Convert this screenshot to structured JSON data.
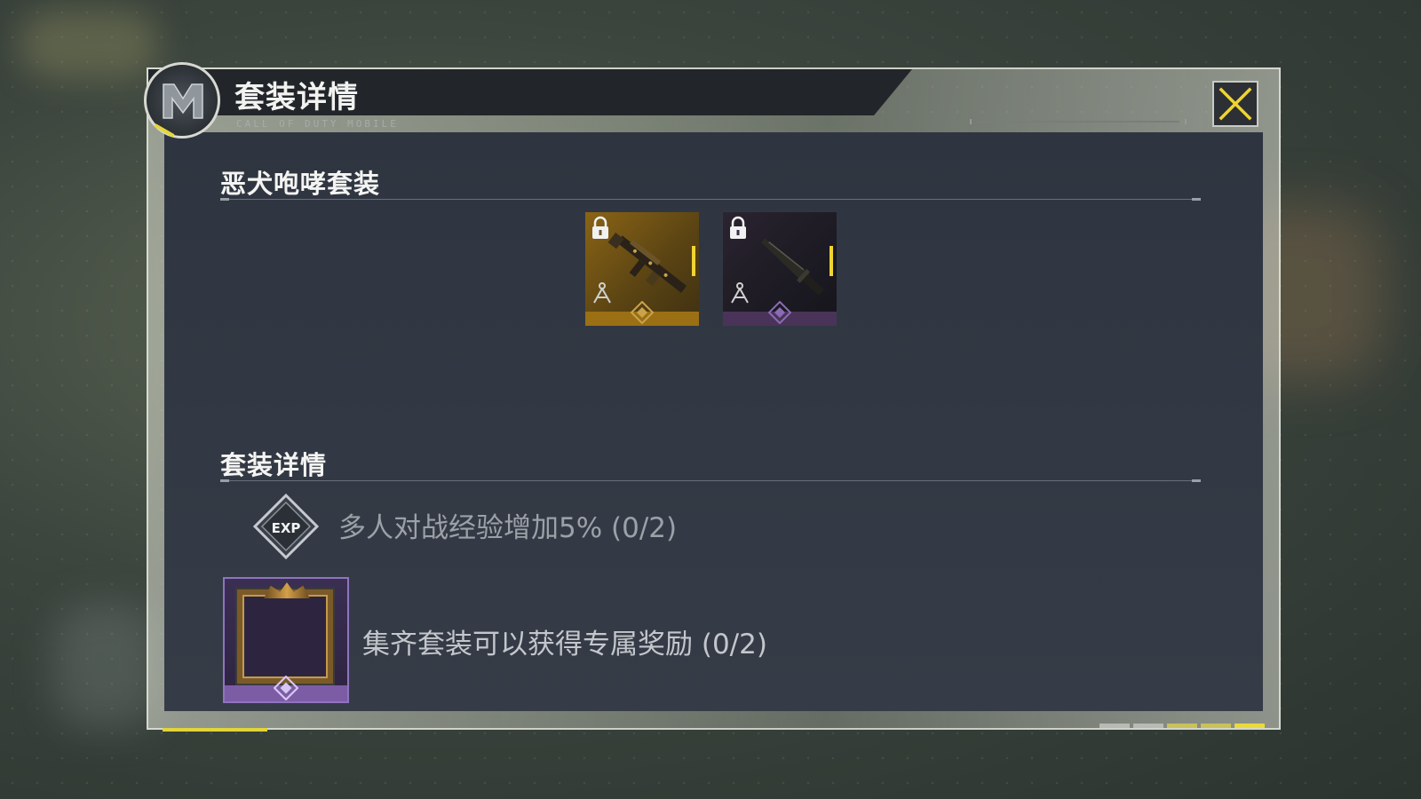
{
  "header": {
    "title": "套装详情",
    "subtitle": "CALL OF DUTY MOBILE"
  },
  "set": {
    "section_title": "恶犬咆哮套装",
    "items": [
      {
        "rarity": "legendary",
        "color": "#9b6f14",
        "icon": "assault-rifle-icon",
        "locked": true
      },
      {
        "rarity": "epic",
        "color": "#4a3358",
        "icon": "knife-icon",
        "locked": true
      }
    ]
  },
  "details": {
    "section_title": "套装详情",
    "bonus": {
      "icon": "exp-boost-icon",
      "icon_text": "EXP",
      "text": "多人对战经验增加5% (0/2)"
    },
    "reward": {
      "icon": "avatar-frame-icon",
      "text": "集齐套装可以获得专属奖励 (0/2)"
    }
  },
  "pager": {
    "pages": 5,
    "colors": [
      "#b8bab5",
      "#b8bab5",
      "#c9c25a",
      "#c9c25a",
      "#ebd93b"
    ]
  },
  "colors": {
    "accent": "#f0d431",
    "legendary": "#9b6f14",
    "epic": "#7d5ca6"
  }
}
